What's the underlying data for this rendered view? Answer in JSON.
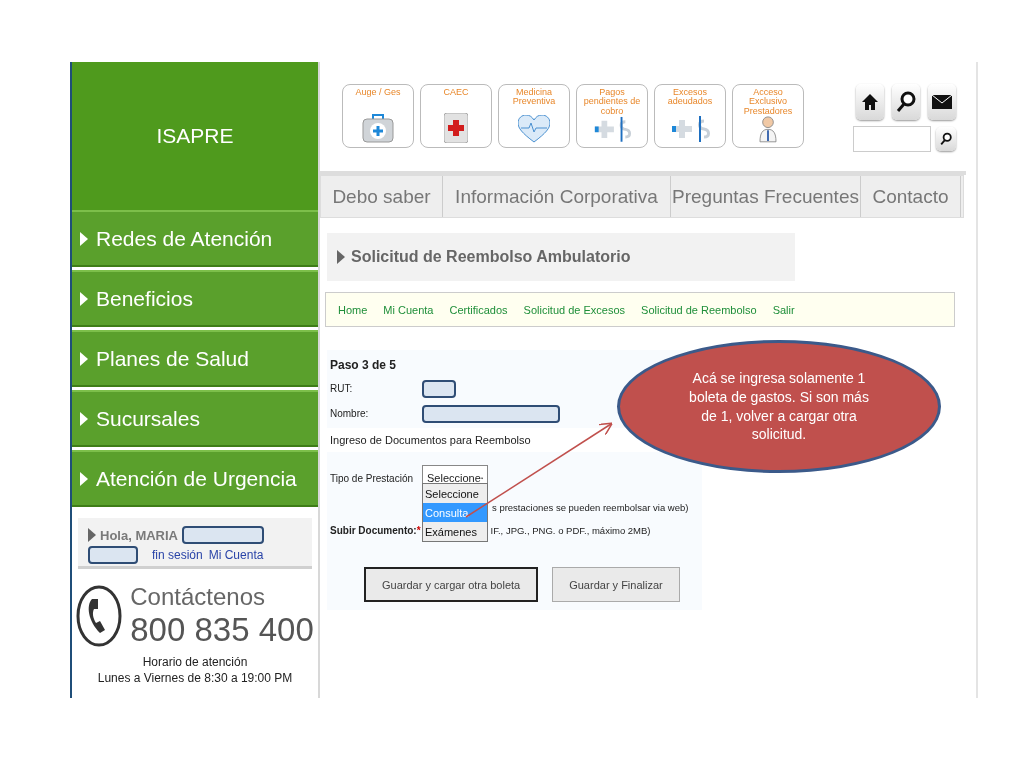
{
  "sidebar": {
    "brand": "ISAPRE",
    "menu": [
      "Redes de Atención",
      "Beneficios",
      "Planes de Salud",
      "Sucursales",
      "Atención de Urgencia"
    ],
    "user": {
      "greeting": "Hola, MARIA",
      "links": [
        "fin sesión",
        "Mi Cuenta"
      ]
    },
    "contact": {
      "title": "Contáctenos",
      "phone": "800 835 400",
      "hours_title": "Horario de atención",
      "hours": "Lunes a Viernes de 8:30 a 19:00 PM"
    }
  },
  "shortcuts": [
    {
      "label": "Auge / Ges",
      "kind": "kit"
    },
    {
      "label": "CAEC",
      "kind": "cross"
    },
    {
      "label": "Medicina Preventiva",
      "kind": "heart"
    },
    {
      "label": "Pagos pendientes de cobro",
      "kind": "plus-dollar"
    },
    {
      "label": "Excesos adeudados",
      "kind": "plus-dollar"
    },
    {
      "label": "Acceso Exclusivo Prestadores",
      "kind": "doctor"
    }
  ],
  "nav": [
    "Debo saber",
    "Información Corporativa",
    "Preguntas Frecuentes",
    "Contacto"
  ],
  "page_title": "Solicitud de Reembolso Ambulatorio",
  "breadcrumbs": [
    "Home",
    "Mi Cuenta",
    "Certificados",
    "Solicitud de Excesos",
    "Solicitud de Reembolso",
    "Salir"
  ],
  "form": {
    "step": "Paso 3 de 5",
    "fields": [
      {
        "label": "RUT:"
      },
      {
        "label": "Nombre:"
      }
    ],
    "section": "Ingreso de Documentos para Reembolso",
    "type_label": "Tipo de Prestación",
    "select_value": "Seleccione",
    "options": [
      {
        "label": "Seleccione",
        "selected": false
      },
      {
        "label": "Consulta",
        "selected": true
      },
      {
        "label": "Exámenes",
        "selected": false
      }
    ],
    "note": "s prestaciones se pueden reembolsar via web)",
    "upload_label": "Subir Documento:",
    "required_mark": "*",
    "upload_note": "IF., JPG., PNG. o PDF., máximo 2MB)",
    "buttons": [
      {
        "label": "Guardar y cargar otra boleta",
        "focused": true
      },
      {
        "label": "Guardar y Finalizar",
        "focused": false
      }
    ]
  },
  "callout": {
    "text": "Acá se ingresa solamente 1 boleta de gastos. Si son más de 1,  volver a cargar  otra solicitud."
  }
}
